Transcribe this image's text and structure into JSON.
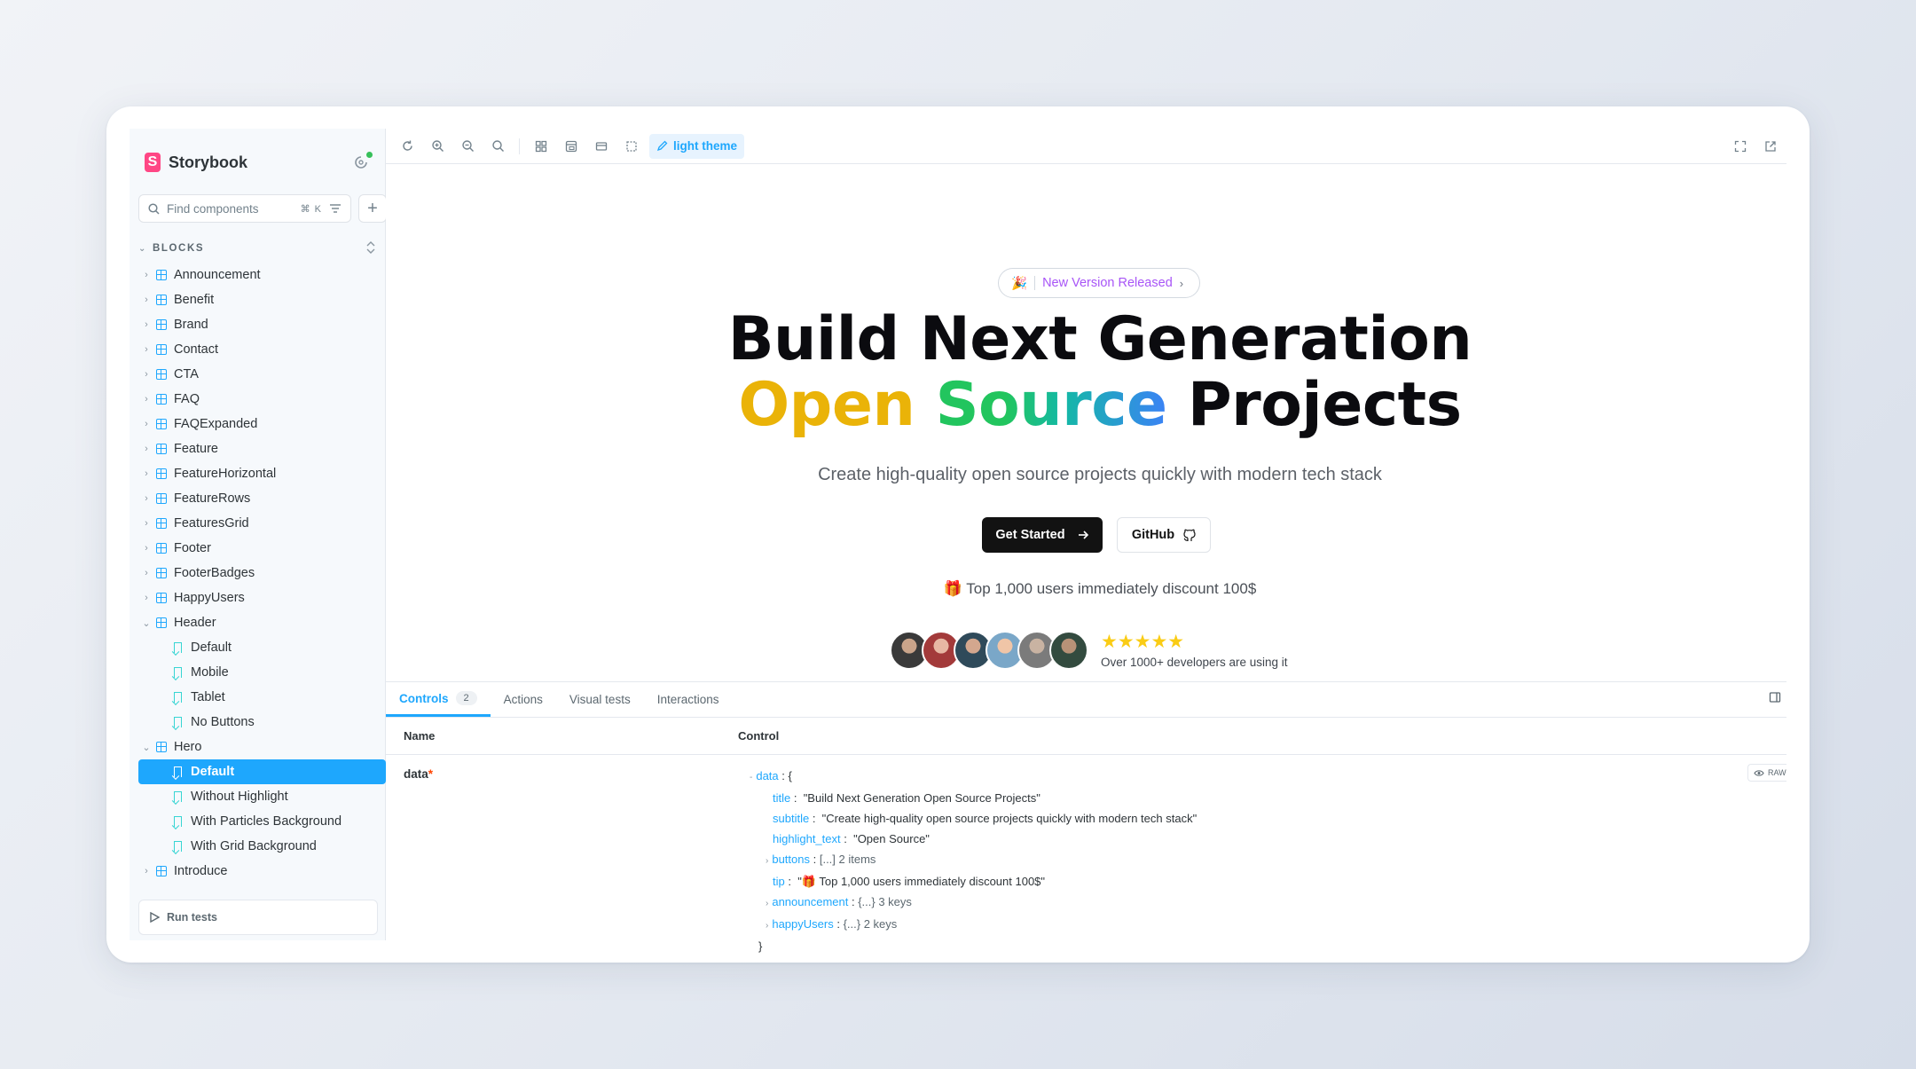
{
  "sidebar": {
    "brand": "Storybook",
    "search_placeholder": "Find components",
    "search_shortcut": "⌘ K",
    "group_label": "BLOCKS",
    "items": [
      {
        "label": "Announcement",
        "kind": "component",
        "expanded": false
      },
      {
        "label": "Benefit",
        "kind": "component",
        "expanded": false
      },
      {
        "label": "Brand",
        "kind": "component",
        "expanded": false
      },
      {
        "label": "Contact",
        "kind": "component",
        "expanded": false
      },
      {
        "label": "CTA",
        "kind": "component",
        "expanded": false
      },
      {
        "label": "FAQ",
        "kind": "component",
        "expanded": false
      },
      {
        "label": "FAQExpanded",
        "kind": "component",
        "expanded": false
      },
      {
        "label": "Feature",
        "kind": "component",
        "expanded": false
      },
      {
        "label": "FeatureHorizontal",
        "kind": "component",
        "expanded": false
      },
      {
        "label": "FeatureRows",
        "kind": "component",
        "expanded": false
      },
      {
        "label": "FeaturesGrid",
        "kind": "component",
        "expanded": false
      },
      {
        "label": "Footer",
        "kind": "component",
        "expanded": false
      },
      {
        "label": "FooterBadges",
        "kind": "component",
        "expanded": false
      },
      {
        "label": "HappyUsers",
        "kind": "component",
        "expanded": false
      },
      {
        "label": "Header",
        "kind": "component",
        "expanded": true
      },
      {
        "label": "Default",
        "kind": "story"
      },
      {
        "label": "Mobile",
        "kind": "story"
      },
      {
        "label": "Tablet",
        "kind": "story"
      },
      {
        "label": "No Buttons",
        "kind": "story"
      },
      {
        "label": "Hero",
        "kind": "component",
        "expanded": true
      },
      {
        "label": "Default",
        "kind": "story",
        "selected": true
      },
      {
        "label": "Without Highlight",
        "kind": "story"
      },
      {
        "label": "With Particles Background",
        "kind": "story"
      },
      {
        "label": "With Grid Background",
        "kind": "story"
      },
      {
        "label": "Introduce",
        "kind": "component",
        "expanded": false
      }
    ],
    "run_tests": "Run tests"
  },
  "toolbar": {
    "theme_label": "light theme",
    "icons": [
      "reload-icon",
      "zoom-in-icon",
      "zoom-out-icon",
      "zoom-reset-icon",
      "grid-icon",
      "background-icon",
      "viewport-icon",
      "outline-icon"
    ]
  },
  "hero": {
    "announcement_emoji": "🎉",
    "announcement": "New Version Released",
    "title_line1": "Build Next Generation",
    "title_hl1": "Open",
    "title_hl2": "Source",
    "title_rest": "Projects",
    "subtitle": "Create high-quality open source projects quickly with modern tech stack",
    "primary_button": "Get Started",
    "secondary_button": "GitHub",
    "tip": "🎁 Top 1,000 users immediately discount 100$",
    "stars": "★★★★★",
    "rating": 5,
    "users_text": "Over 1000+ developers are using it"
  },
  "addons": {
    "tabs": [
      {
        "label": "Controls",
        "count": "2"
      },
      {
        "label": "Actions"
      },
      {
        "label": "Visual tests"
      },
      {
        "label": "Interactions"
      }
    ],
    "col_name": "Name",
    "col_control": "Control",
    "row_name": "data",
    "required_mark": "*",
    "raw_label": "RAW",
    "json": {
      "root_key": "data",
      "open": "{",
      "close": "}",
      "title_key": "title",
      "title_val": "\"Build Next Generation Open Source Projects\"",
      "subtitle_key": "subtitle",
      "subtitle_val": "\"Create high-quality open source projects quickly with modern tech stack\"",
      "highlight_key": "highlight_text",
      "highlight_val": "\"Open Source\"",
      "buttons_key": "buttons",
      "buttons_meta": "[...] 2 items",
      "tip_key": "tip",
      "tip_val": "\"🎁 Top 1,000 users immediately discount 100$\"",
      "announcement_key": "announcement",
      "announcement_meta": "{...} 3 keys",
      "happy_key": "happyUsers",
      "happy_meta": "{...} 2 keys"
    }
  }
}
